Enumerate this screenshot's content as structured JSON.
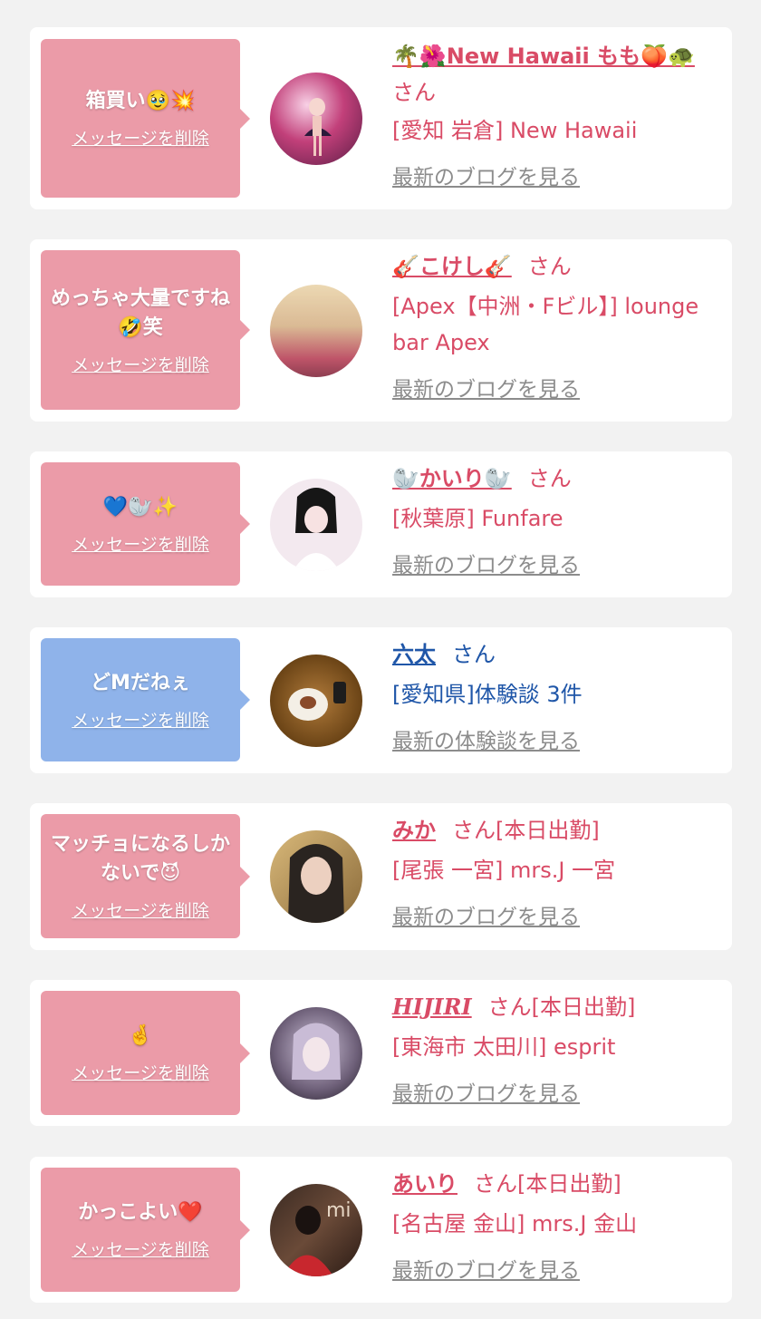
{
  "delete_label": "メッセージを削除",
  "items": [
    {
      "message": "箱買い🥹💥",
      "name": "🌴🌺New Hawaii もも🍑🐢",
      "san": "さん",
      "shop": "[愛知 岩倉] New Hawaii",
      "link": "最新のブログを見る"
    },
    {
      "message": "めっちゃ大量ですね🤣笑",
      "name": "🎸こけし🎸",
      "san": "さん",
      "shop": "[Apex【中洲・Fビル】] lounge bar Apex",
      "link": "最新のブログを見る"
    },
    {
      "message": "💙🦭✨",
      "name": "🦭かいり🦭",
      "san": "さん",
      "shop": "[秋葉原] Funfare",
      "link": "最新のブログを見る"
    },
    {
      "message": "どMだねぇ",
      "name": "六太",
      "san": "さん",
      "shop": "[愛知県]体験談 3件",
      "link": "最新の体験談を見る"
    },
    {
      "message": "マッチョになるしかないで😈",
      "name": "みか",
      "san": "さん[本日出勤]",
      "shop": "[尾張 一宮] mrs.J 一宮",
      "link": "最新のブログを見る"
    },
    {
      "message": "🤞",
      "name": "HIJIRI",
      "san": "さん[本日出勤]",
      "shop": "[東海市 太田川] esprit",
      "link": "最新のブログを見る"
    },
    {
      "message": "かっこよい❤️",
      "name": "あいり",
      "san": "さん[本日出勤]",
      "shop": "[名古屋 金山] mrs.J 金山",
      "link": "最新のブログを見る"
    }
  ],
  "colors": {
    "pink_bubble": "#eb9ba8",
    "blue_bubble": "#8fb3ea",
    "pink_text": "#d94b66",
    "blue_text": "#1f56a8",
    "link_gray": "#8c8c8c"
  }
}
